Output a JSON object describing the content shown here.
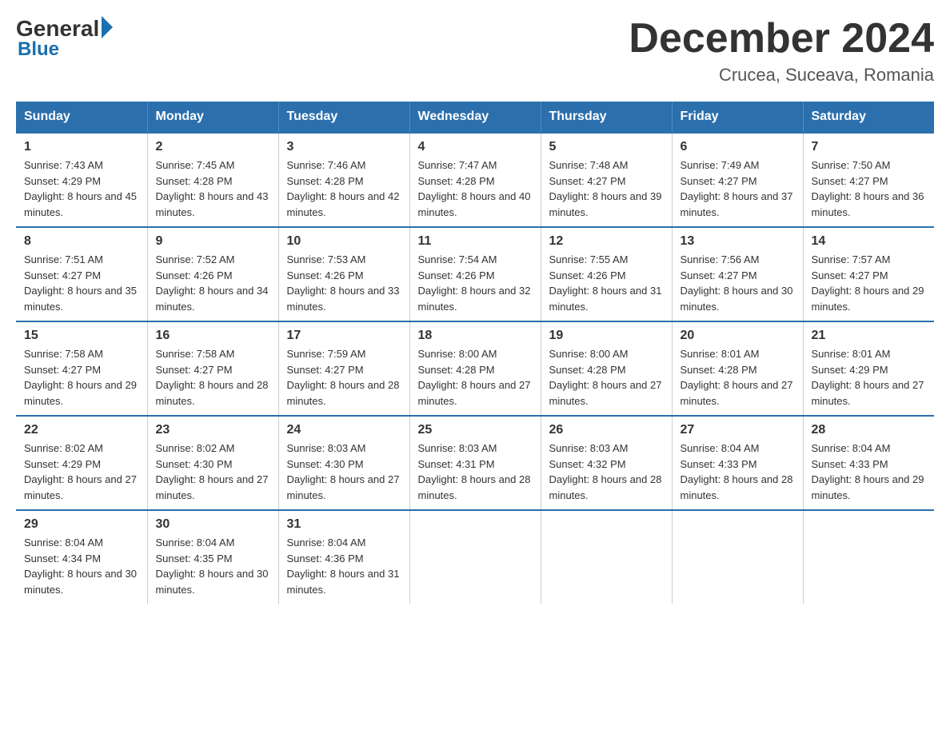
{
  "header": {
    "logo": {
      "general": "General",
      "blue": "Blue"
    },
    "title": "December 2024",
    "location": "Crucea, Suceava, Romania"
  },
  "days_of_week": [
    "Sunday",
    "Monday",
    "Tuesday",
    "Wednesday",
    "Thursday",
    "Friday",
    "Saturday"
  ],
  "weeks": [
    [
      {
        "day": "1",
        "sunrise": "7:43 AM",
        "sunset": "4:29 PM",
        "daylight": "8 hours and 45 minutes."
      },
      {
        "day": "2",
        "sunrise": "7:45 AM",
        "sunset": "4:28 PM",
        "daylight": "8 hours and 43 minutes."
      },
      {
        "day": "3",
        "sunrise": "7:46 AM",
        "sunset": "4:28 PM",
        "daylight": "8 hours and 42 minutes."
      },
      {
        "day": "4",
        "sunrise": "7:47 AM",
        "sunset": "4:28 PM",
        "daylight": "8 hours and 40 minutes."
      },
      {
        "day": "5",
        "sunrise": "7:48 AM",
        "sunset": "4:27 PM",
        "daylight": "8 hours and 39 minutes."
      },
      {
        "day": "6",
        "sunrise": "7:49 AM",
        "sunset": "4:27 PM",
        "daylight": "8 hours and 37 minutes."
      },
      {
        "day": "7",
        "sunrise": "7:50 AM",
        "sunset": "4:27 PM",
        "daylight": "8 hours and 36 minutes."
      }
    ],
    [
      {
        "day": "8",
        "sunrise": "7:51 AM",
        "sunset": "4:27 PM",
        "daylight": "8 hours and 35 minutes."
      },
      {
        "day": "9",
        "sunrise": "7:52 AM",
        "sunset": "4:26 PM",
        "daylight": "8 hours and 34 minutes."
      },
      {
        "day": "10",
        "sunrise": "7:53 AM",
        "sunset": "4:26 PM",
        "daylight": "8 hours and 33 minutes."
      },
      {
        "day": "11",
        "sunrise": "7:54 AM",
        "sunset": "4:26 PM",
        "daylight": "8 hours and 32 minutes."
      },
      {
        "day": "12",
        "sunrise": "7:55 AM",
        "sunset": "4:26 PM",
        "daylight": "8 hours and 31 minutes."
      },
      {
        "day": "13",
        "sunrise": "7:56 AM",
        "sunset": "4:27 PM",
        "daylight": "8 hours and 30 minutes."
      },
      {
        "day": "14",
        "sunrise": "7:57 AM",
        "sunset": "4:27 PM",
        "daylight": "8 hours and 29 minutes."
      }
    ],
    [
      {
        "day": "15",
        "sunrise": "7:58 AM",
        "sunset": "4:27 PM",
        "daylight": "8 hours and 29 minutes."
      },
      {
        "day": "16",
        "sunrise": "7:58 AM",
        "sunset": "4:27 PM",
        "daylight": "8 hours and 28 minutes."
      },
      {
        "day": "17",
        "sunrise": "7:59 AM",
        "sunset": "4:27 PM",
        "daylight": "8 hours and 28 minutes."
      },
      {
        "day": "18",
        "sunrise": "8:00 AM",
        "sunset": "4:28 PM",
        "daylight": "8 hours and 27 minutes."
      },
      {
        "day": "19",
        "sunrise": "8:00 AM",
        "sunset": "4:28 PM",
        "daylight": "8 hours and 27 minutes."
      },
      {
        "day": "20",
        "sunrise": "8:01 AM",
        "sunset": "4:28 PM",
        "daylight": "8 hours and 27 minutes."
      },
      {
        "day": "21",
        "sunrise": "8:01 AM",
        "sunset": "4:29 PM",
        "daylight": "8 hours and 27 minutes."
      }
    ],
    [
      {
        "day": "22",
        "sunrise": "8:02 AM",
        "sunset": "4:29 PM",
        "daylight": "8 hours and 27 minutes."
      },
      {
        "day": "23",
        "sunrise": "8:02 AM",
        "sunset": "4:30 PM",
        "daylight": "8 hours and 27 minutes."
      },
      {
        "day": "24",
        "sunrise": "8:03 AM",
        "sunset": "4:30 PM",
        "daylight": "8 hours and 27 minutes."
      },
      {
        "day": "25",
        "sunrise": "8:03 AM",
        "sunset": "4:31 PM",
        "daylight": "8 hours and 28 minutes."
      },
      {
        "day": "26",
        "sunrise": "8:03 AM",
        "sunset": "4:32 PM",
        "daylight": "8 hours and 28 minutes."
      },
      {
        "day": "27",
        "sunrise": "8:04 AM",
        "sunset": "4:33 PM",
        "daylight": "8 hours and 28 minutes."
      },
      {
        "day": "28",
        "sunrise": "8:04 AM",
        "sunset": "4:33 PM",
        "daylight": "8 hours and 29 minutes."
      }
    ],
    [
      {
        "day": "29",
        "sunrise": "8:04 AM",
        "sunset": "4:34 PM",
        "daylight": "8 hours and 30 minutes."
      },
      {
        "day": "30",
        "sunrise": "8:04 AM",
        "sunset": "4:35 PM",
        "daylight": "8 hours and 30 minutes."
      },
      {
        "day": "31",
        "sunrise": "8:04 AM",
        "sunset": "4:36 PM",
        "daylight": "8 hours and 31 minutes."
      },
      null,
      null,
      null,
      null
    ]
  ]
}
